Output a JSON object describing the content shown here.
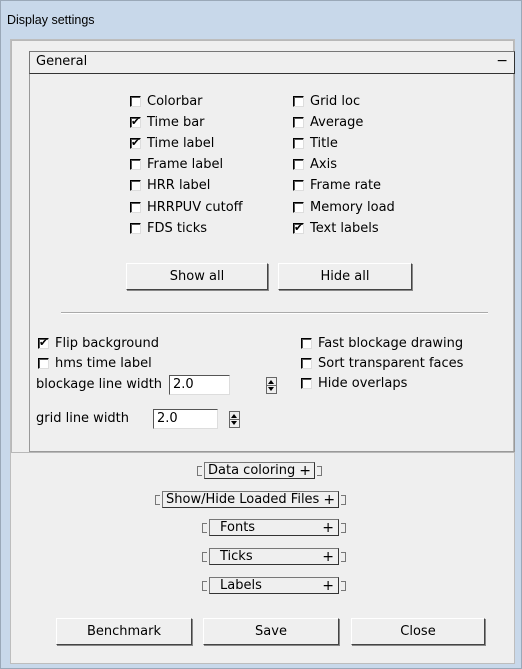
{
  "window": {
    "title": "Display settings"
  },
  "general": {
    "header": "General",
    "collapse_glyph": "−",
    "left_checks": [
      {
        "label": "Colorbar",
        "checked": false
      },
      {
        "label": "Time bar",
        "checked": true
      },
      {
        "label": "Time label",
        "checked": true
      },
      {
        "label": "Frame label",
        "checked": false
      },
      {
        "label": "HRR label",
        "checked": false
      },
      {
        "label": "HRRPUV cutoff",
        "checked": false
      },
      {
        "label": "FDS ticks",
        "checked": false
      }
    ],
    "right_checks": [
      {
        "label": "Grid loc",
        "checked": false
      },
      {
        "label": "Average",
        "checked": false
      },
      {
        "label": "Title",
        "checked": false
      },
      {
        "label": "Axis",
        "checked": false
      },
      {
        "label": "Frame rate",
        "checked": false
      },
      {
        "label": "Memory load",
        "checked": false
      },
      {
        "label": "Text labels",
        "checked": true
      }
    ],
    "show_all": "Show all",
    "hide_all": "Hide all",
    "lower_left_checks": [
      {
        "label": "Flip background",
        "checked": true
      },
      {
        "label": "hms time label",
        "checked": false
      }
    ],
    "lower_right_checks": [
      {
        "label": "Fast blockage drawing",
        "checked": false
      },
      {
        "label": "Sort transparent faces",
        "checked": false
      },
      {
        "label": "Hide overlaps",
        "checked": false
      }
    ],
    "blockage_line_width_label": "blockage line width",
    "blockage_line_width_value": "2.0",
    "grid_line_width_label": "grid line width",
    "grid_line_width_value": "2.0"
  },
  "rollouts": [
    {
      "label": "Data coloring",
      "glyph": "+"
    },
    {
      "label": "Show/Hide Loaded Files",
      "glyph": "+"
    },
    {
      "label": "Fonts",
      "glyph": "+"
    },
    {
      "label": "Ticks",
      "glyph": "+"
    },
    {
      "label": "Labels",
      "glyph": "+"
    }
  ],
  "buttons": {
    "benchmark": "Benchmark",
    "save": "Save",
    "close": "Close"
  },
  "check_glyph": "✔"
}
